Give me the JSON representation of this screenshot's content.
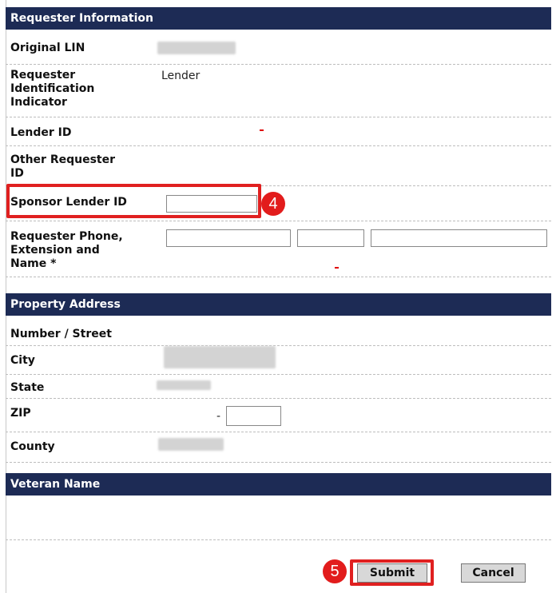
{
  "requester_section": {
    "title": "Requester Information",
    "original_lin_label": "Original LIN",
    "rii_label_1": "Requester",
    "rii_label_2": "Identification",
    "rii_label_3": "Indicator",
    "rii_value": "Lender",
    "lender_id_label": "Lender ID",
    "other_requester_label_1": "Other Requester",
    "other_requester_label_2": "ID",
    "sponsor_lender_label": "Sponsor Lender ID",
    "sponsor_lender_value": "",
    "phone_label_1": "Requester Phone,",
    "phone_label_2": "Extension and",
    "phone_label_3": "Name *",
    "phone_value": "",
    "extension_value": "",
    "name_value": ""
  },
  "property_section": {
    "title": "Property Address",
    "street_label": "Number / Street",
    "city_label": "City",
    "state_label": "State",
    "zip_label": "ZIP",
    "zip_dash": "-",
    "zip_ext_value": "",
    "county_label": "County"
  },
  "veteran_section": {
    "title": "Veteran Name"
  },
  "actions": {
    "submit_label": "Submit",
    "cancel_label": "Cancel"
  },
  "callouts": {
    "step_4": "4",
    "step_5": "5"
  },
  "colors": {
    "header_bg": "#1d2b55",
    "highlight": "#e02020"
  }
}
